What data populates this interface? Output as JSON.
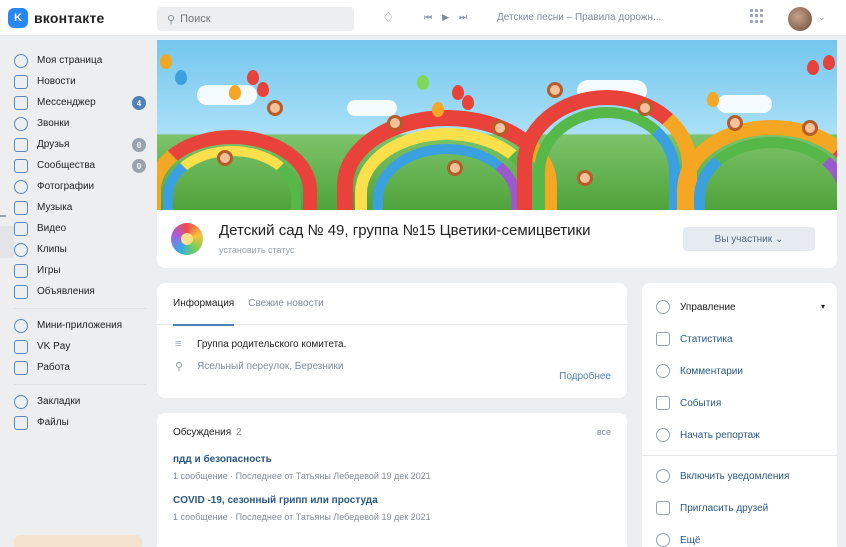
{
  "app": {
    "logo_letter": "K",
    "logo_text": "вконтакте"
  },
  "search": {
    "placeholder": "Поиск"
  },
  "player": {
    "track": "Детские песни – Правила дорожн..."
  },
  "sidebar": {
    "items": [
      {
        "label": "Моя страница",
        "icon": "user-icon"
      },
      {
        "label": "Новости",
        "icon": "news-icon"
      },
      {
        "label": "Мессенджер",
        "icon": "chat-icon",
        "badge": "4"
      },
      {
        "label": "Звонки",
        "icon": "phone-icon"
      },
      {
        "label": "Друзья",
        "icon": "friends-icon",
        "badge": "0"
      },
      {
        "label": "Сообщества",
        "icon": "communities-icon",
        "badge": "0"
      },
      {
        "label": "Фотографии",
        "icon": "photo-icon"
      },
      {
        "label": "Музыка",
        "icon": "music-icon"
      },
      {
        "label": "Видео",
        "icon": "video-icon"
      },
      {
        "label": "Клипы",
        "icon": "clips-icon"
      },
      {
        "label": "Игры",
        "icon": "games-icon"
      },
      {
        "label": "Объявления",
        "icon": "ads-icon"
      }
    ],
    "items2": [
      {
        "label": "Мини-приложения",
        "icon": "apps-icon"
      },
      {
        "label": "VK Pay",
        "icon": "vkpay-icon"
      },
      {
        "label": "Работа",
        "icon": "work-icon"
      }
    ],
    "items3": [
      {
        "label": "Закладки",
        "icon": "bookmarks-icon"
      },
      {
        "label": "Файлы",
        "icon": "files-icon"
      }
    ]
  },
  "group": {
    "title": "Детский сад № 49, группа №15 Цветики-семицветики",
    "status": "установить статус",
    "member_button": "Вы участник"
  },
  "info": {
    "tabs": [
      "Информация",
      "Свежие новости"
    ],
    "description": "Группа родительского комитета.",
    "address": "Ясельный переулок, Березники",
    "more": "Подробнее"
  },
  "discussions": {
    "title": "Обсуждения",
    "count": "2",
    "all": "все",
    "topics": [
      {
        "title": "пдд и безопасность",
        "meta": "1 сообщение · Последнее от Татьяны Лебедевой 19 дек 2021"
      },
      {
        "title": "COVID -19, сезонный грипп или простуда",
        "meta": "1 сообщение · Последнее от Татьяны Лебедевой 19 дек 2021"
      }
    ]
  },
  "menu": {
    "items": [
      {
        "label": "Управление",
        "icon": "gear-icon"
      },
      {
        "label": "Статистика",
        "icon": "stats-icon"
      },
      {
        "label": "Комментарии",
        "icon": "comments-icon"
      },
      {
        "label": "События",
        "icon": "events-icon"
      },
      {
        "label": "Начать репортаж",
        "icon": "live-icon"
      }
    ],
    "items2": [
      {
        "label": "Включить уведомления",
        "icon": "bell-icon"
      },
      {
        "label": "Пригласить друзей",
        "icon": "invite-icon"
      },
      {
        "label": "Ещё",
        "icon": "chevron-down-icon"
      }
    ]
  }
}
